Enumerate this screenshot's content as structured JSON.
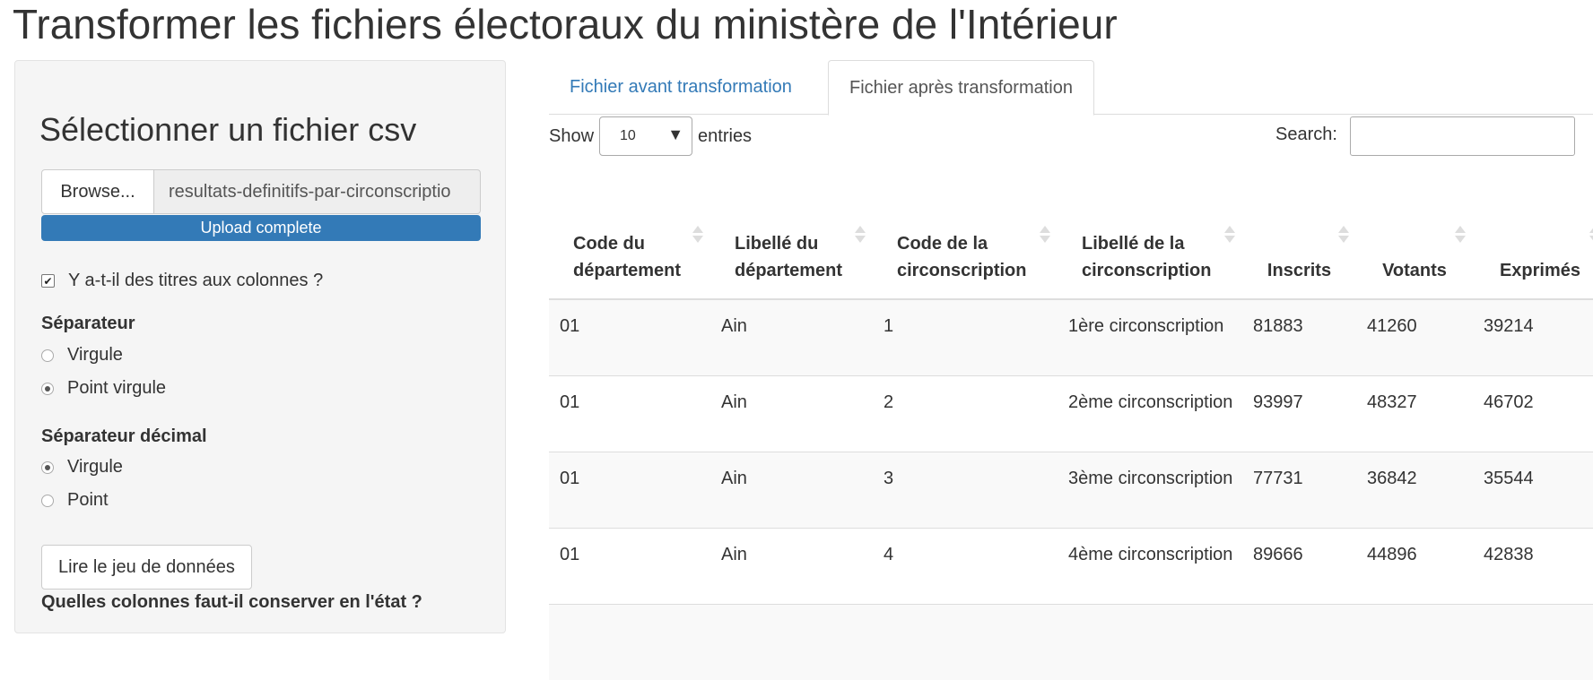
{
  "page": {
    "title": "Transformer les fichiers électoraux du ministère de l'Intérieur"
  },
  "sidebar": {
    "heading": "Sélectionner un fichier csv",
    "browse_label": "Browse...",
    "file_name": "resultats-definitifs-par-circonscriptio",
    "progress_label": "Upload complete",
    "progress_value": 1.0,
    "header_checkbox": {
      "label": "Y a-t-il des titres aux colonnes ?",
      "checked": true
    },
    "separator": {
      "label": "Séparateur",
      "options": [
        {
          "label": "Virgule",
          "checked": false
        },
        {
          "label": "Point virgule",
          "checked": true
        }
      ]
    },
    "decimal": {
      "label": "Séparateur décimal",
      "options": [
        {
          "label": "Virgule",
          "checked": true
        },
        {
          "label": "Point",
          "checked": false
        }
      ]
    },
    "read_button": "Lire le jeu de données",
    "keep_columns_label": "Quelles colonnes faut-il conserver en l'état ?"
  },
  "tabs": [
    {
      "label": "Fichier avant transformation",
      "active": false
    },
    {
      "label": "Fichier après transformation",
      "active": true
    }
  ],
  "table_controls": {
    "show_label": "Show",
    "length_value": "10",
    "entries_label": "entries",
    "search_label": "Search:",
    "search_value": ""
  },
  "table": {
    "columns": [
      "Code du département",
      "Libellé du département",
      "Code de la circonscription",
      "Libellé de la circonscription",
      "Inscrits",
      "Votants",
      "Exprimés"
    ],
    "rows": [
      [
        "01",
        "Ain",
        "1",
        "1ère circonscription",
        "81883",
        "41260",
        "39214"
      ],
      [
        "01",
        "Ain",
        "2",
        "2ème circonscription",
        "93997",
        "48327",
        "46702"
      ],
      [
        "01",
        "Ain",
        "3",
        "3ème circonscription",
        "77731",
        "36842",
        "35544"
      ],
      [
        "01",
        "Ain",
        "4",
        "4ème circonscription",
        "89666",
        "44896",
        "42838"
      ],
      [
        "",
        "",
        "",
        "",
        "",
        "",
        ""
      ]
    ]
  }
}
